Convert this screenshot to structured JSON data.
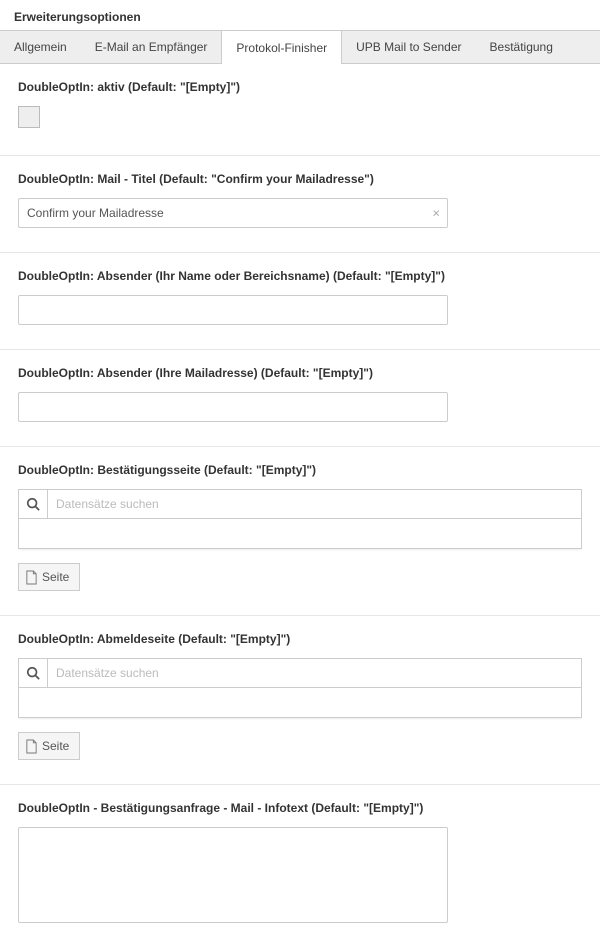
{
  "header": "Erweiterungsoptionen",
  "tabs": {
    "general": "Allgemein",
    "mail_recipient": "E-Mail an Empfänger",
    "protocol": "Protokol-Finisher",
    "upb_mail": "UPB Mail to Sender",
    "confirm": "Bestätigung"
  },
  "labels": {
    "active": "DoubleOptIn: aktiv (Default: \"[Empty]\")",
    "mail_title": "DoubleOptIn: Mail - Titel (Default: \"Confirm your Mailadresse\")",
    "sender_name": "DoubleOptIn: Absender (Ihr Name oder Bereichsname) (Default: \"[Empty]\")",
    "sender_mail": "DoubleOptIn: Absender (Ihre Mailadresse) (Default: \"[Empty]\")",
    "confirm_page": "DoubleOptIn: Bestätigungsseite (Default: \"[Empty]\")",
    "unsub_page": "DoubleOptIn: Abmeldeseite (Default: \"[Empty]\")",
    "infotext": "DoubleOptIn - Bestätigungsanfrage - Mail - Infotext (Default: \"[Empty]\")"
  },
  "values": {
    "mail_title": "Confirm your Mailadresse",
    "sender_name": "",
    "sender_mail": "",
    "infotext": ""
  },
  "search": {
    "placeholder1": "Datensätze suchen",
    "placeholder2": "Datensätze suchen"
  },
  "buttons": {
    "page": "Seite"
  }
}
